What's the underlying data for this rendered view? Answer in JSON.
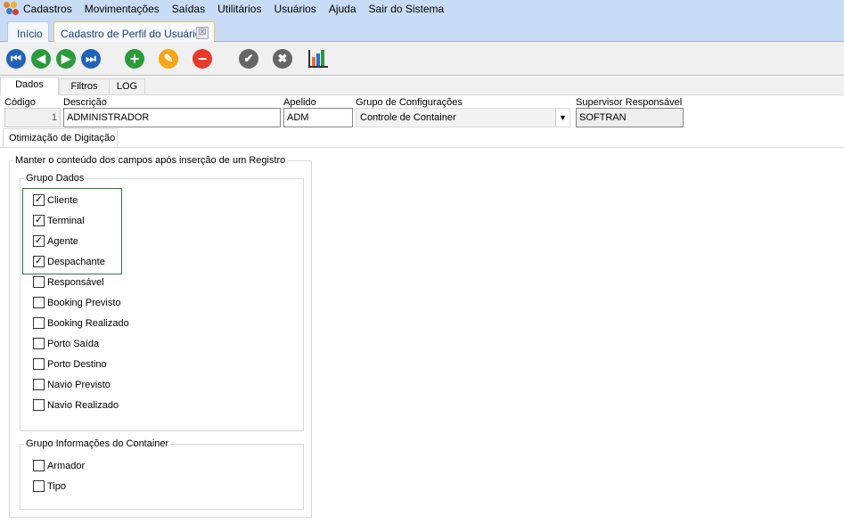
{
  "menu": [
    "Cadastros",
    "Movimentações",
    "Saídas",
    "Utilitários",
    "Usuários",
    "Ajuda",
    "Sair do Sistema"
  ],
  "tabs": {
    "home": "Início",
    "active": "Cadastro de Perfil do Usuário",
    "close": "☒"
  },
  "toolbar": {
    "first": "⏮",
    "prev": "◀",
    "next": "▶",
    "last": "⏭",
    "add": "+",
    "edit": "✎",
    "delete": "−",
    "confirm": "✔",
    "cancel": "✖"
  },
  "page_tabs": [
    "Dados",
    "Filtros",
    "LOG"
  ],
  "form": {
    "codigo_label": "Código",
    "codigo": "1",
    "descricao_label": "Descrição",
    "descricao": "ADMINISTRADOR",
    "apelido_label": "Apelido",
    "apelido": "ADM",
    "grupo_label": "Grupo de Configurações",
    "grupo": "Controle de Container",
    "supervisor_label": "Supervisor Responsável",
    "supervisor": "SOFTRAN"
  },
  "subtab": "Otimização de Digitação",
  "outer_group": "Manter o conteúdo dos campos após inserção de um Registro",
  "grupo_dados": {
    "title": "Grupo Dados",
    "items": [
      {
        "label": "Cliente",
        "checked": true
      },
      {
        "label": "Terminal",
        "checked": true
      },
      {
        "label": "Agente",
        "checked": true
      },
      {
        "label": "Despachante",
        "checked": true
      },
      {
        "label": "Responsável",
        "checked": false
      },
      {
        "label": "Booking Previsto",
        "checked": false
      },
      {
        "label": "Booking Realizado",
        "checked": false
      },
      {
        "label": "Porto Saída",
        "checked": false
      },
      {
        "label": "Porto Destino",
        "checked": false
      },
      {
        "label": "Navio Previsto",
        "checked": false
      },
      {
        "label": "Navio Realizado",
        "checked": false
      }
    ]
  },
  "grupo_container": {
    "title": "Grupo Informações do Container",
    "items": [
      {
        "label": "Armador",
        "checked": false
      },
      {
        "label": "Tipo",
        "checked": false
      }
    ]
  }
}
